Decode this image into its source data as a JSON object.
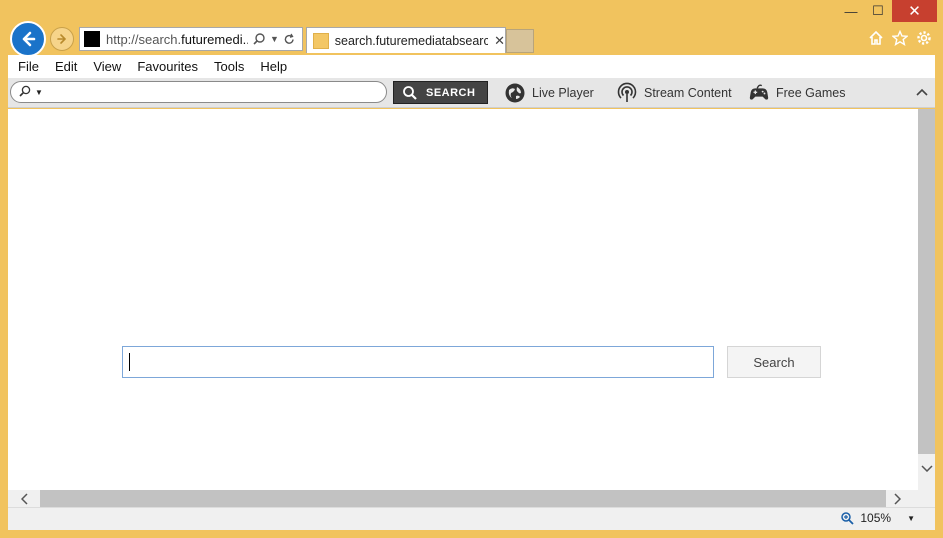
{
  "window": {
    "minimize": "—",
    "maximize": "☐",
    "close": "✕"
  },
  "address": {
    "url_prefix": "http://search.",
    "url_highlight": "futuremedi...",
    "search_icon": "search-icon",
    "refresh_icon": "refresh-icon"
  },
  "tab": {
    "title": "search.futuremediatabsearc...",
    "close": "✕"
  },
  "menu": [
    "File",
    "Edit",
    "View",
    "Favourites",
    "Tools",
    "Help"
  ],
  "toolbar": {
    "search_button": "SEARCH",
    "links": [
      {
        "label": "Live Player",
        "icon": "globe-icon"
      },
      {
        "label": "Stream Content",
        "icon": "broadcast-icon"
      },
      {
        "label": "Free Games",
        "icon": "gamepad-icon"
      }
    ]
  },
  "page": {
    "search_input_value": "",
    "search_button": "Search"
  },
  "status": {
    "zoom": "105%"
  }
}
